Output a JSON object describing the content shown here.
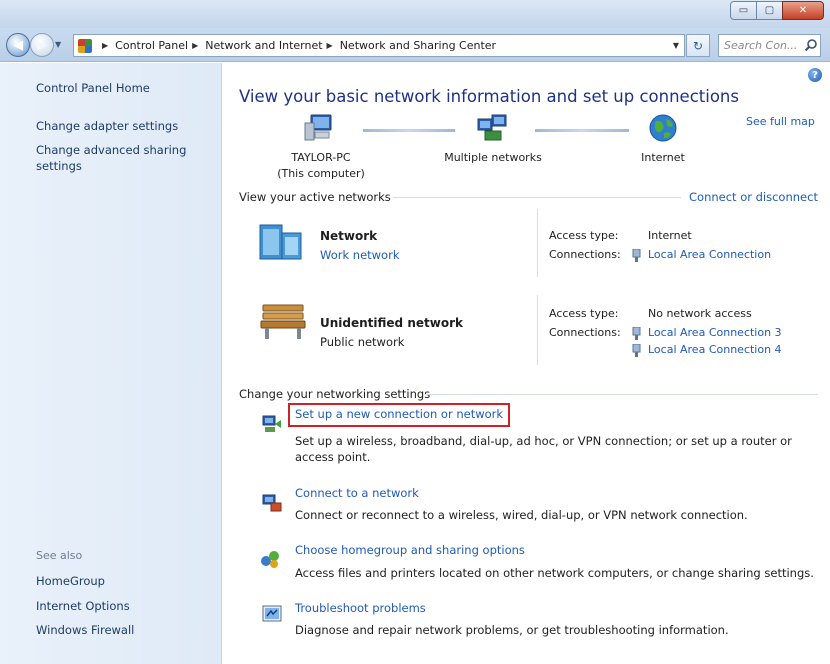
{
  "window": {
    "buttons": {
      "minimize": "▭",
      "maximize": "▢",
      "close": "✕"
    }
  },
  "nav": {
    "back_icon": "◀",
    "forward_icon": "▶",
    "recent_icon": "▼",
    "breadcrumbs": [
      "Control Panel",
      "Network and Internet",
      "Network and Sharing Center"
    ],
    "crumb_separator": "▶",
    "dropdown_icon": "▼",
    "refresh_icon": "↻",
    "search_placeholder": "Search Con..."
  },
  "sidebar": {
    "items": [
      {
        "label": "Control Panel Home"
      },
      {
        "label": "Change adapter settings"
      },
      {
        "label": "Change advanced sharing settings"
      }
    ],
    "see_also": {
      "heading": "See also",
      "items": [
        {
          "label": "HomeGroup"
        },
        {
          "label": "Internet Options"
        },
        {
          "label": "Windows Firewall"
        }
      ]
    }
  },
  "main": {
    "help_icon": "?",
    "title": "View your basic network information and set up connections",
    "see_full_map": "See full map",
    "map": {
      "computer_name": "TAYLOR-PC",
      "computer_sub": "(This computer)",
      "middle": "Multiple networks",
      "internet": "Internet"
    },
    "active_networks": {
      "heading": "View your active networks",
      "connect_link": "Connect or disconnect",
      "networks": [
        {
          "name": "Network",
          "type": "Work network",
          "access_label": "Access type:",
          "access_value": "Internet",
          "connections_label": "Connections:",
          "connections": [
            "Local Area Connection"
          ]
        },
        {
          "name": "Unidentified network",
          "type": "Public network",
          "access_label": "Access type:",
          "access_value": "No network access",
          "connections_label": "Connections:",
          "connections": [
            "Local Area Connection 3",
            "Local Area Connection 4"
          ]
        }
      ]
    },
    "settings": {
      "heading": "Change your networking settings",
      "tasks": [
        {
          "title": "Set up a new connection or network",
          "desc": "Set up a wireless, broadband, dial-up, ad hoc, or VPN connection; or set up a router or access point."
        },
        {
          "title": "Connect to a network",
          "desc": "Connect or reconnect to a wireless, wired, dial-up, or VPN network connection."
        },
        {
          "title": "Choose homegroup and sharing options",
          "desc": "Access files and printers located on other network computers, or change sharing settings."
        },
        {
          "title": "Troubleshoot problems",
          "desc": "Diagnose and repair network problems, or get troubleshooting information."
        }
      ]
    }
  }
}
